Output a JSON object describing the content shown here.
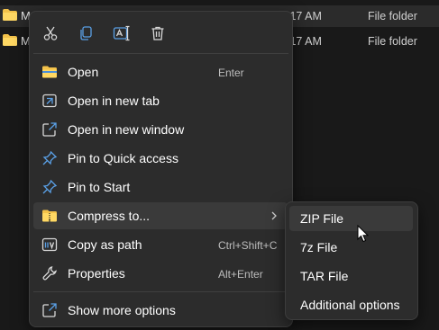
{
  "files": [
    {
      "name": "M",
      "time": ":17 AM",
      "type": "File folder"
    },
    {
      "name": "M",
      "time": ":17 AM",
      "type": "File folder"
    }
  ],
  "quick_actions": [
    {
      "icon": "cut-icon"
    },
    {
      "icon": "copy-icon"
    },
    {
      "icon": "rename-icon"
    },
    {
      "icon": "delete-icon"
    }
  ],
  "menu": {
    "items": [
      {
        "label": "Open",
        "accel": "Enter",
        "icon": "folder-open-icon"
      },
      {
        "label": "Open in new tab",
        "accel": "",
        "icon": "new-tab-icon"
      },
      {
        "label": "Open in new window",
        "accel": "",
        "icon": "new-window-icon"
      },
      {
        "label": "Pin to Quick access",
        "accel": "",
        "icon": "pin-icon"
      },
      {
        "label": "Pin to Start",
        "accel": "",
        "icon": "pin-icon"
      },
      {
        "label": "Compress to...",
        "accel": "",
        "icon": "archive-icon"
      },
      {
        "label": "Copy as path",
        "accel": "Ctrl+Shift+C",
        "icon": "path-icon"
      },
      {
        "label": "Properties",
        "accel": "Alt+Enter",
        "icon": "wrench-icon"
      },
      {
        "label": "Show more options",
        "accel": "",
        "icon": "more-options-icon"
      }
    ]
  },
  "submenu": {
    "items": [
      {
        "label": "ZIP File"
      },
      {
        "label": "7z File"
      },
      {
        "label": "TAR File"
      },
      {
        "label": "Additional options"
      }
    ]
  },
  "colors": {
    "background": "#191919",
    "menu_bg": "#2c2c2c",
    "hover_bg": "#3a3a3a",
    "accent_blue": "#5aa0e6",
    "folder_yellow": "#f3c24a"
  }
}
